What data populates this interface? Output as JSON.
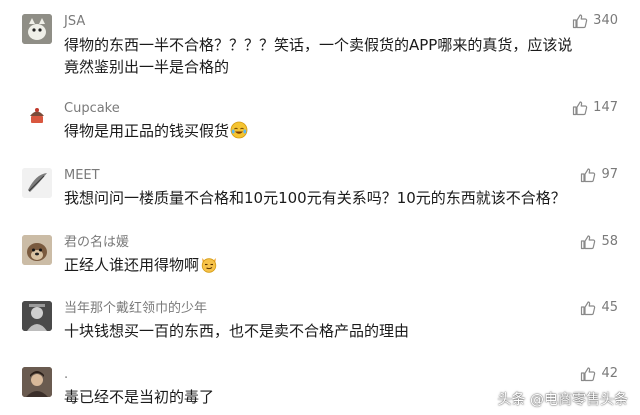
{
  "comments": [
    {
      "user": "JSA",
      "likes": "340",
      "text": "得物的东西一半不合格？？？？笑话，一个卖假货的APP哪来的真货，应该说竟然鉴别出一半是合格的",
      "avatar": "cat-avatar"
    },
    {
      "user": "Cupcake",
      "likes": "147",
      "text": "得物是用正品的钱买假货",
      "emoji": "laughing-tears-emoji",
      "avatar": "cupcake-avatar"
    },
    {
      "user": "MEET",
      "likes": "97",
      "text": "我想问问一楼质量不合格和10元100元有关系吗？10元的东西就该不合格？",
      "avatar": "leaf-avatar"
    },
    {
      "user": "君の名は媛",
      "likes": "58",
      "text": "正经人谁还用得物啊",
      "emoji": "smirk-cat-emoji",
      "avatar": "dog-avatar"
    },
    {
      "user": "当年那个戴红领巾的少年",
      "likes": "45",
      "text": "十块钱想买一百的东西，也不是卖不合格产品的理由",
      "avatar": "sketch-avatar"
    },
    {
      "user": ".",
      "likes": "42",
      "text": "毒已经不是当初的毒了",
      "avatar": "portrait-avatar"
    }
  ],
  "watermark": "头条 @电商零售头条",
  "colors": {
    "text": "#1a1a1a",
    "meta": "#7a7a7a",
    "background": "#ffffff"
  }
}
